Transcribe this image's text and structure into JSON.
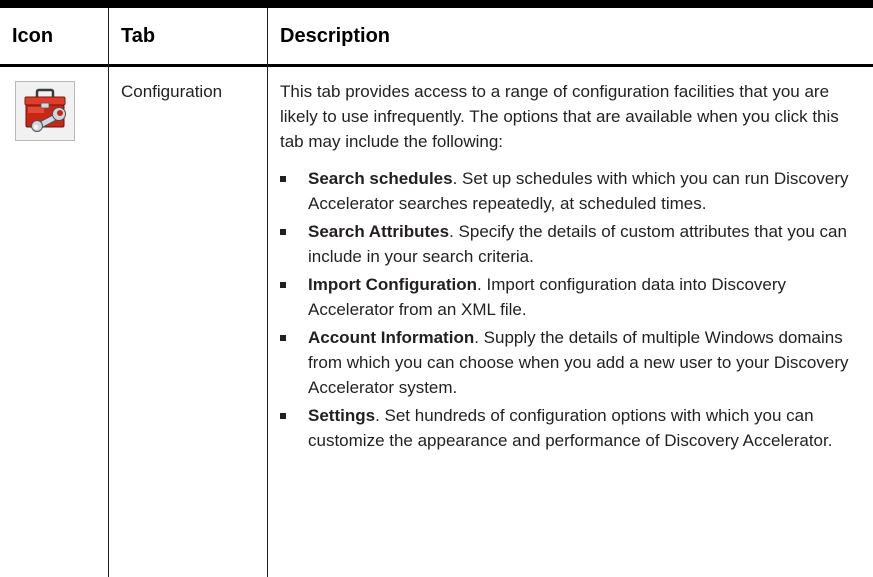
{
  "headers": {
    "icon": "Icon",
    "tab": "Tab",
    "description": "Description"
  },
  "row": {
    "icon_name": "toolbox-wrench-icon",
    "tab": "Configuration",
    "intro": "This tab provides access to a range of configuration facilities that you are likely to use infrequently. The options that are available when you click this tab may include the following:",
    "items": [
      {
        "term": "Search schedules",
        "text": ". Set up schedules with which you can run Discovery Accelerator searches repeatedly, at scheduled times."
      },
      {
        "term": "Search Attributes",
        "text": ". Specify the details of custom attributes that you can include in your search criteria."
      },
      {
        "term": "Import Configuration",
        "text": ". Import configuration data into Discovery Accelerator from an XML file."
      },
      {
        "term": "Account Information",
        "text": ". Supply the details of multiple Windows domains from which you can choose when you add a new user to your Discovery Accelerator system."
      },
      {
        "term": "Settings",
        "text": ". Set hundreds of configuration options with which you can customize the appearance and performance of Discovery Accelerator."
      }
    ]
  }
}
